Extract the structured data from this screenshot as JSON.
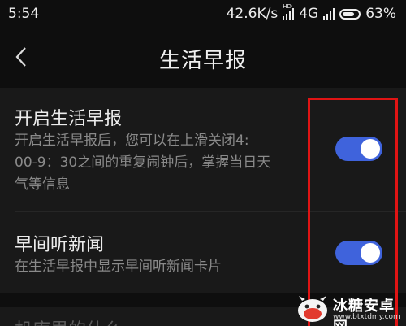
{
  "status_bar": {
    "time": "5:54",
    "net_speed": "42.6K/s",
    "network_label": "4G",
    "battery": "63%"
  },
  "header": {
    "title": "生活早报"
  },
  "settings": [
    {
      "title": "开启生活早报",
      "description_lines": [
        "开启生活早报后，您可以在上滑关闭4:",
        "00-9：30之间的重复闹钟后，掌握当日天",
        "气等信息"
      ],
      "enabled": true
    },
    {
      "title": "早间听新闻",
      "description_lines": [
        "在生活早报中显示早间听新闻卡片"
      ],
      "enabled": true
    }
  ],
  "next_item": {
    "title": "机库里的什么"
  },
  "watermark": {
    "name": "冰糖安卓网",
    "url": "www.btxtdmy.com"
  },
  "colors": {
    "toggle_on": "#3f63dc",
    "highlight": "#e01414"
  }
}
